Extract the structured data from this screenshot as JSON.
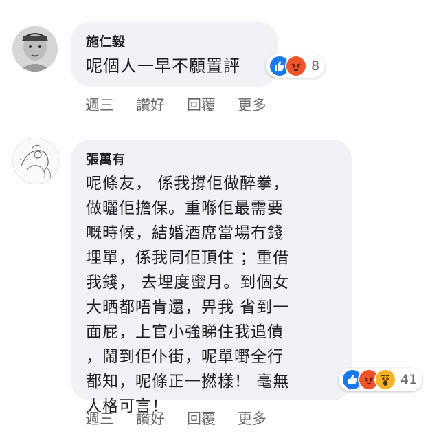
{
  "comments": [
    {
      "author": "施仁毅",
      "text": "呢個人一早不願置評",
      "reaction_count": "8",
      "reactions": [
        "like-icon",
        "angry-icon"
      ],
      "actions": {
        "time": "週三",
        "like": "讚好",
        "reply": "回覆",
        "more": "更多"
      }
    },
    {
      "author": "張萬有",
      "text": "呢條友， 係我撐佢做醉拳，\n做曬佢擔保。重喺佢最需要\n嘅時候，結婚酒席當場冇錢\n埋單，係我同佢頂住 ；重借\n我錢， 去埋度蜜月。到個女\n大晒都唔肯還，畀我 省到一\n面屁，上官小強睇住我追債\n，鬧到佢仆街，呢單嘢全行\n都知，呢條正一撚樣！ 毫無\n人格可言！",
      "reaction_count": "41",
      "reactions": [
        "like-icon",
        "angry-icon",
        "wow-icon"
      ],
      "actions": {
        "time": "週三",
        "like": "讚好",
        "reply": "回覆",
        "more": "更多"
      }
    }
  ],
  "colors": {
    "bubble": "#f0f2f5",
    "like_blue": "#1877f2",
    "angry_orange": "#f0542a",
    "wow_yellow": "#f7b125",
    "muted_text": "#65676b"
  }
}
